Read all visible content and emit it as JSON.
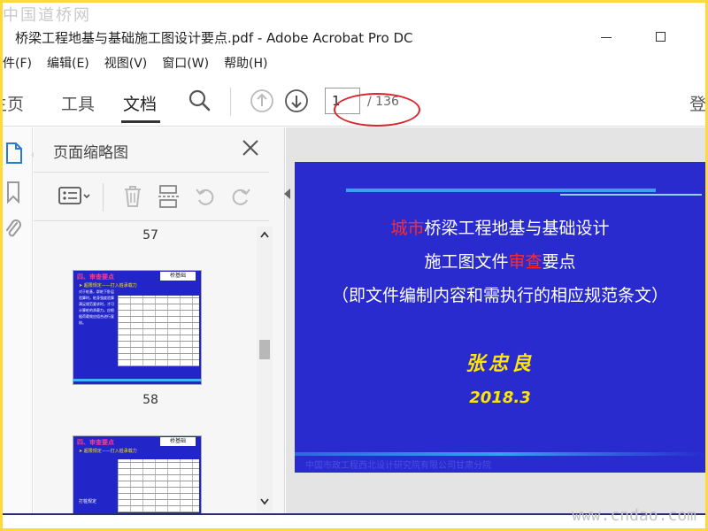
{
  "watermarks": {
    "top_left": "中国道桥网",
    "bottom_right": "www.cndao.com"
  },
  "window": {
    "title": "桥梁工程地基与基础施工图设计要点.pdf - Adobe Acrobat Pro DC"
  },
  "menu": {
    "items": [
      "件(F)",
      "编辑(E)",
      "视图(V)",
      "窗口(W)",
      "帮助(H)"
    ]
  },
  "toolbar": {
    "tabs": [
      "主页",
      "工具",
      "文档"
    ],
    "active_tab": "文档",
    "page_current": "1",
    "page_total": "/ 136",
    "login": "登"
  },
  "panel": {
    "title": "页面缩略图",
    "thumbnails": [
      {
        "label": "57"
      },
      {
        "label": "58",
        "heading": "四、审查要点",
        "badge": "桥基础",
        "subtitle": "➤ 超限规定——打入桩承载力",
        "body": "对于桩基，群桩下卧层验算时，桩身强度验算满足规范要求时，才可计算桩的承载力。应根据荷载效应组合进行复核。"
      },
      {
        "label": "",
        "heading": "四、审查要点",
        "badge": "桥基础",
        "subtitle": "➤ 超限规定——打入桩承载力",
        "body": "打桩规定"
      }
    ]
  },
  "slide": {
    "line1_red": "城市",
    "line1_rest": "桥梁工程地基与基础设计",
    "line2_a": "施工图文件",
    "line2_red": "审查",
    "line2_b": "要点",
    "line3": "（即文件编制内容和需执行的相应规范条文）",
    "author": "张忠良",
    "date": "2018.3",
    "footer": "中国市政工程西北设计研究院有限公司甘肃分院"
  },
  "colors": {
    "slide_bg": "#2a2bcf",
    "accent_red": "#ff2a2a",
    "accent_yellow": "#ffe600",
    "highlight_ellipse": "#d8262c",
    "frame_border": "#ffd83a"
  }
}
